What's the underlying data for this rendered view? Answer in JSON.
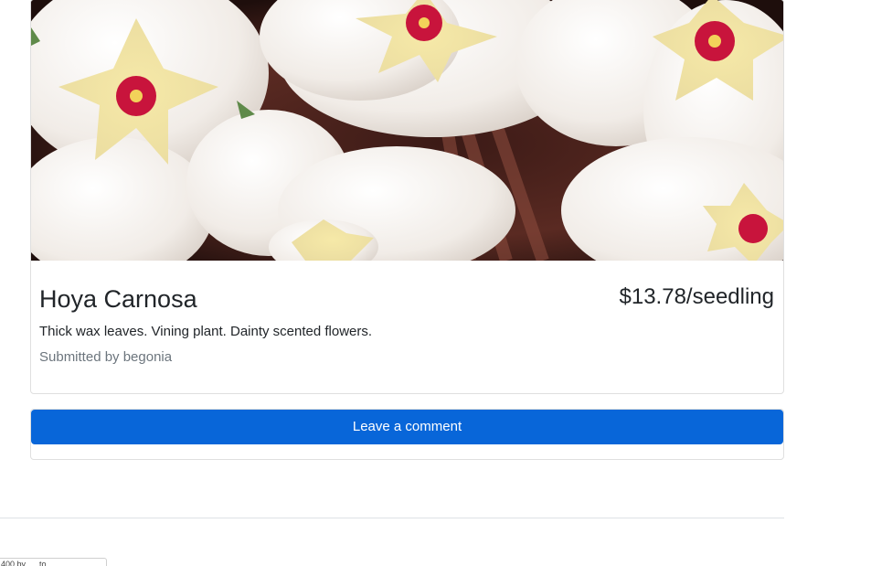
{
  "product": {
    "image_alt": "Hoya Carnosa flowers",
    "name": "Hoya Carnosa",
    "price": "$13.78/seedling",
    "description": "Thick wax leaves. Vining plant. Dainty scented flowers.",
    "submitted": "Submitted by begonia"
  },
  "comments": {
    "button_label": "Leave a comment"
  },
  "status_tip": {
    "text": "400 by . . .to . . . ."
  },
  "colors": {
    "primary_button": "#0866d9",
    "muted_text": "#6c757d",
    "border": "#dfdfdf"
  }
}
